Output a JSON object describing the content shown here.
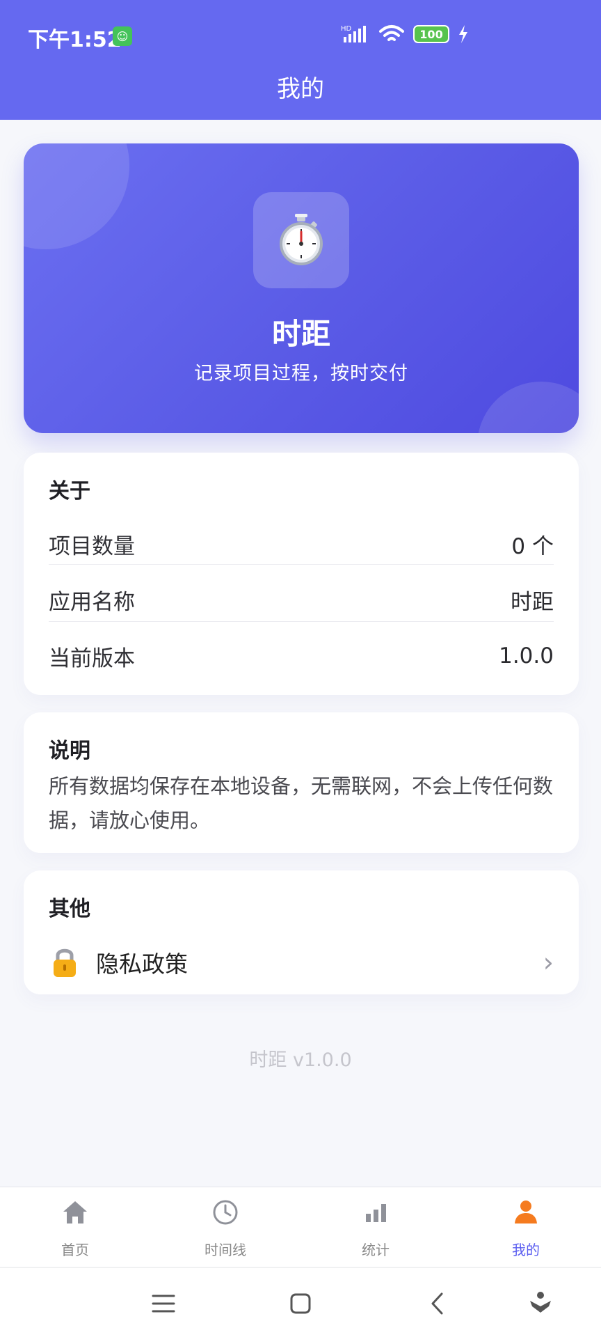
{
  "status_bar": {
    "time": "下午1:52",
    "app_badge": "☺",
    "signal_label": "HD",
    "battery": "100"
  },
  "header": {
    "title": "我的"
  },
  "hero": {
    "app_name": "时距",
    "subtitle": "记录项目过程，按时交付",
    "icon": "stopwatch-icon"
  },
  "about": {
    "title": "关于",
    "rows": [
      {
        "label": "项目数量",
        "value": "0 个"
      },
      {
        "label": "应用名称",
        "value": "时距"
      },
      {
        "label": "当前版本",
        "value": "1.0.0"
      }
    ]
  },
  "description": {
    "title": "说明",
    "text": "所有数据均保存在本地设备，无需联网，不会上传任何数据，请放心使用。"
  },
  "other": {
    "title": "其他",
    "privacy_label": "隐私政策",
    "privacy_icon": "lock-icon"
  },
  "footer": {
    "version": "时距 v1.0.0"
  },
  "tabs": [
    {
      "label": "首页",
      "icon": "home-icon"
    },
    {
      "label": "时间线",
      "icon": "clock-icon"
    },
    {
      "label": "统计",
      "icon": "bar-chart-icon"
    },
    {
      "label": "我的",
      "icon": "user-icon"
    }
  ],
  "colors": {
    "primary": "#6569F0",
    "active": "#5B5EF0",
    "inactive": "#888888"
  }
}
